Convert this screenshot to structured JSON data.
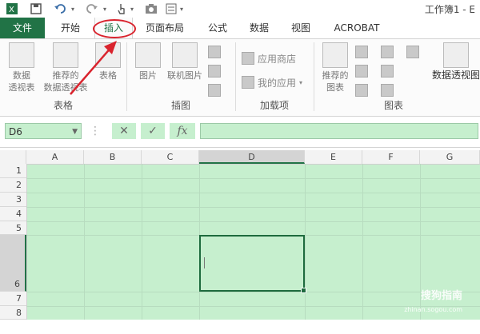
{
  "window": {
    "title": "工作簿1 - E"
  },
  "tabs": [
    {
      "label": "文件"
    },
    {
      "label": "开始"
    },
    {
      "label": "插入"
    },
    {
      "label": "页面布局"
    },
    {
      "label": "公式"
    },
    {
      "label": "数据"
    },
    {
      "label": "视图"
    },
    {
      "label": "ACROBAT"
    }
  ],
  "ribbon": {
    "tables": {
      "pivot": "数据\n透视表",
      "recommended_pivot": "推荐的\n数据透视表",
      "table": "表格",
      "group": "表格"
    },
    "illustrations": {
      "pictures": "图片",
      "online_pictures": "联机图片",
      "group": "插图"
    },
    "addins": {
      "store": "应用商店",
      "my_apps": "我的应用",
      "group": "加载项"
    },
    "charts": {
      "recommended": "推荐的\n图表",
      "pivot_chart": "数据透视图",
      "group": "图表"
    }
  },
  "formula_bar": {
    "name_box": "D6",
    "cancel": "✕",
    "enter": "✓",
    "fx": "fx",
    "value": ""
  },
  "grid": {
    "columns": [
      "A",
      "B",
      "C",
      "D",
      "E",
      "F",
      "G"
    ],
    "rows": [
      "1",
      "2",
      "3",
      "4",
      "5",
      "6",
      "7",
      "8"
    ],
    "active_cell": "D6"
  },
  "watermark": {
    "text": "搜狗指南",
    "sub": "zhinan.sogou.com"
  },
  "colors": {
    "excel_green": "#217346",
    "cell_fill": "#c6efce",
    "annotation_red": "#d9232d"
  }
}
